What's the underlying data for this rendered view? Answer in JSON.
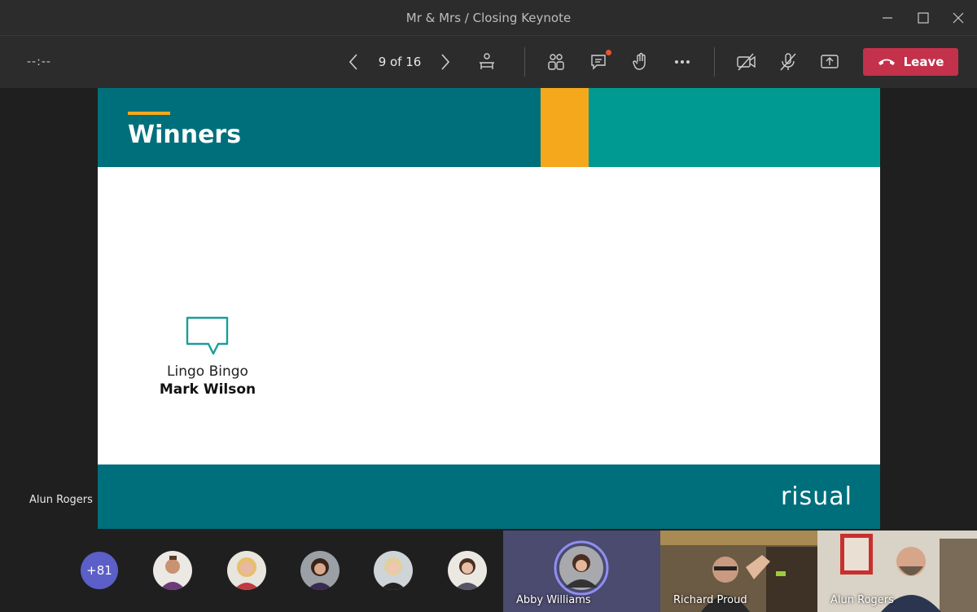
{
  "window": {
    "title": "Mr & Mrs / Closing Keynote"
  },
  "controls": {
    "timer": "--:--",
    "slide_counter": "9 of 16",
    "leave_label": "Leave"
  },
  "slide": {
    "title": "Winners",
    "award": "Lingo Bingo",
    "winner": "Mark Wilson",
    "brand": "risual"
  },
  "presenter": {
    "name": "Alun Rogers"
  },
  "participants": {
    "overflow": "+81",
    "tiles": [
      {
        "name": "Abby Williams"
      },
      {
        "name": "Richard Proud"
      },
      {
        "name": "Alun Rogers"
      }
    ]
  },
  "colors": {
    "leave": "#c4314b",
    "slide_teal": "#006f7c",
    "slide_gold": "#f6a81c",
    "slide_teal_light": "#009a93",
    "overflow_badge": "#5b5fc7"
  }
}
